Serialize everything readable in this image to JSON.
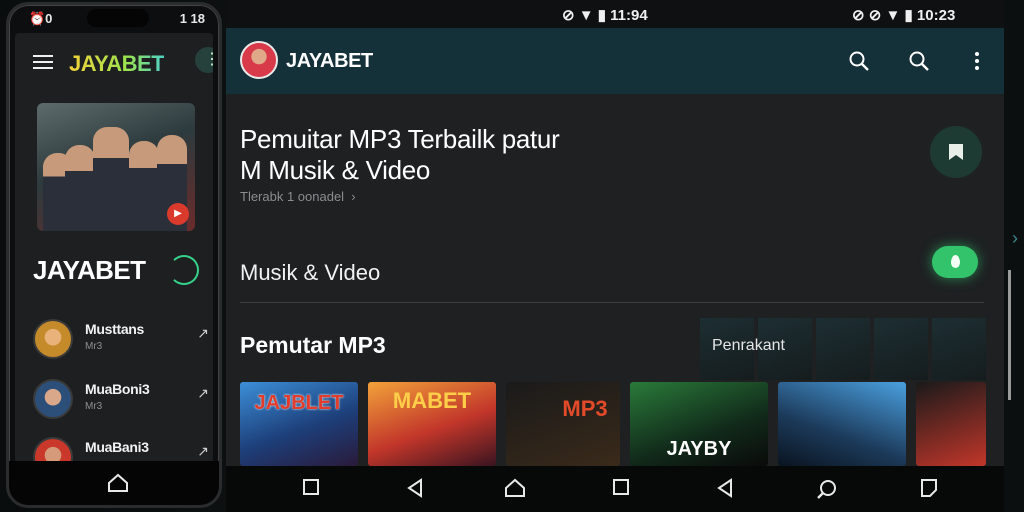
{
  "phone": {
    "status_left": "⏰0",
    "status_right": "1 18",
    "logo": "JAYABET",
    "brand": "JAYABET",
    "items": [
      {
        "title": "Musttans",
        "sub": "Mr3"
      },
      {
        "title": "MuaBoni3",
        "sub": "Mr3"
      },
      {
        "title": "MuaBani3",
        "sub": ""
      }
    ]
  },
  "tablet": {
    "status_time_1": "11:94",
    "status_time_2": "10:23",
    "app_title": "JAYABET",
    "headline_line1": "Pemuitar MP3 Terbailk patur",
    "headline_line2": "M Musik & Video",
    "subtitle": "Tlerabk 1 oonadel",
    "section_music": "Musik & Video",
    "section_mp3": "Pemutar MP3",
    "see_more": "Penrakant",
    "cards": [
      {
        "label": "JAJBLET"
      },
      {
        "label": "MABET"
      },
      {
        "label": "MP3"
      },
      {
        "label": "JAYBY"
      },
      {
        "label": ""
      },
      {
        "label": ""
      }
    ]
  },
  "colors": {
    "topbar": "#143038",
    "accent_green": "#33c36a",
    "background": "#1e2022"
  }
}
